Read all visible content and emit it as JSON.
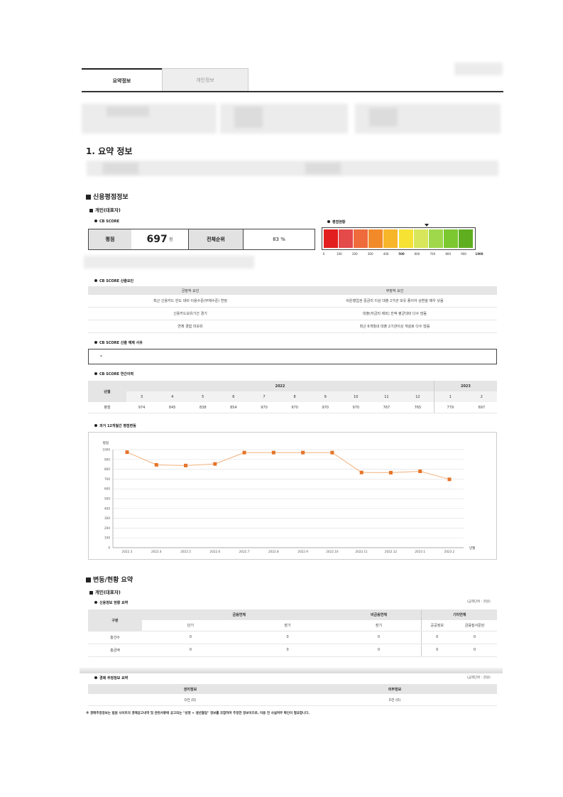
{
  "tabs": [
    {
      "label": "요약정보"
    },
    {
      "label": "개인정보"
    }
  ],
  "section1": {
    "title": "1. 요약 정보"
  },
  "credit": {
    "title": "신용평점정보",
    "subtitle": "개인(대표자)",
    "cb_label": "CB SCORE",
    "score_label": "평점",
    "score_value": "697",
    "score_unit": "점",
    "rank_label": "전체순위",
    "rank_value": "83 %",
    "gauge_label": "평점현황",
    "gauge_ticks": [
      "0",
      "100",
      "200",
      "300",
      "400",
      "500",
      "600",
      "700",
      "800",
      "900",
      "1000"
    ],
    "gauge_colors": [
      "#e31e1e",
      "#e34a4a",
      "#ef6b3b",
      "#f28a2a",
      "#f7b52a",
      "#f5e232",
      "#d7e65a",
      "#9fd84a",
      "#7cc830",
      "#5fae1f"
    ]
  },
  "factors": {
    "title": "CB SCORE 산출요인",
    "positive_header": "긍정적 요인",
    "negative_header": "부정적 요인",
    "positive": [
      "최근 신용카드 한도 대비 이용수준(부채수준) 연정",
      "신용카드보유기간 경기",
      "연체 경험 미보유"
    ],
    "negative": [
      "비은행업권 중금리 이상 대출 2가관 보유 종이어 상환을 매우 낮음",
      "대출(저금리 제외) 잔액 평균대비 다수 많음",
      "최근 6개월내 대출 2기관이상 개설로 다수 많음"
    ]
  },
  "exclusion": {
    "title": "CB SCORE 산출 예제 사유",
    "value": "-"
  },
  "history": {
    "title": "CB SCORE 연간이력",
    "col_header": "년월",
    "row_label": "평점",
    "year1": "2022",
    "year2": "2023",
    "months": [
      "3",
      "4",
      "5",
      "6",
      "7",
      "8",
      "9",
      "10",
      "11",
      "12",
      "1",
      "2"
    ],
    "scores": [
      "974",
      "845",
      "838",
      "854",
      "970",
      "970",
      "970",
      "970",
      "767",
      "765",
      "779",
      "697"
    ]
  },
  "trend": {
    "title": "과거 12개월간 평점변동"
  },
  "chart_data": {
    "type": "line",
    "x": [
      "2022.3",
      "2022.4",
      "2022.5",
      "2022.6",
      "2022.7",
      "2022.8",
      "2022.9",
      "2022.10",
      "2022.11",
      "2022.12",
      "2023.1",
      "2023.2"
    ],
    "values": [
      974,
      845,
      838,
      854,
      970,
      970,
      970,
      970,
      767,
      765,
      779,
      697
    ],
    "ylabel": "평점",
    "xlabel": "년월",
    "ylim": [
      0,
      1000
    ],
    "yticks": [
      "0",
      "100",
      "200",
      "300",
      "400",
      "500",
      "600",
      "700",
      "800",
      "900",
      "1000"
    ],
    "grid": true,
    "line_color": "#f2b07a",
    "marker_color": "#e5742a"
  },
  "change": {
    "title": "변동/현황 요약",
    "subtitle": "개인(대표자)",
    "status_title": "신용정보 현황 요약",
    "unit_note": "(금액단위 : 천원)",
    "h_gubun": "구분",
    "h_fin": "금융연체",
    "h_nonfin": "비금융연체",
    "h_etc": "기타연체",
    "h_short": "단기",
    "h_long": "장기",
    "h_long2": "장기",
    "h_public": "공공정보",
    "h_fraud": "금융질서문란",
    "rows": [
      {
        "label": "총건수",
        "v": [
          "0",
          "0",
          "0",
          "0",
          "0"
        ]
      },
      {
        "label": "총금액",
        "v": [
          "0",
          "0",
          "0",
          "0",
          "0"
        ]
      }
    ]
  },
  "auction": {
    "title": "경매 추정정보 요약",
    "unit_note": "(금액단위 : 천원)",
    "h_rights": "권리정보",
    "h_duty": "의무정보",
    "v_rights": "0건 (0)",
    "v_duty": "0건 (0)",
    "footnote": "※ 경매추정정보는 법원 사이트의 경매공고내역 및 관련서류에 공고되는 \"성명 + 생년월일\" 정보를 조합하여 추정한 정보이므로, 이용 전 사실여부 확인이 필요합니다."
  }
}
